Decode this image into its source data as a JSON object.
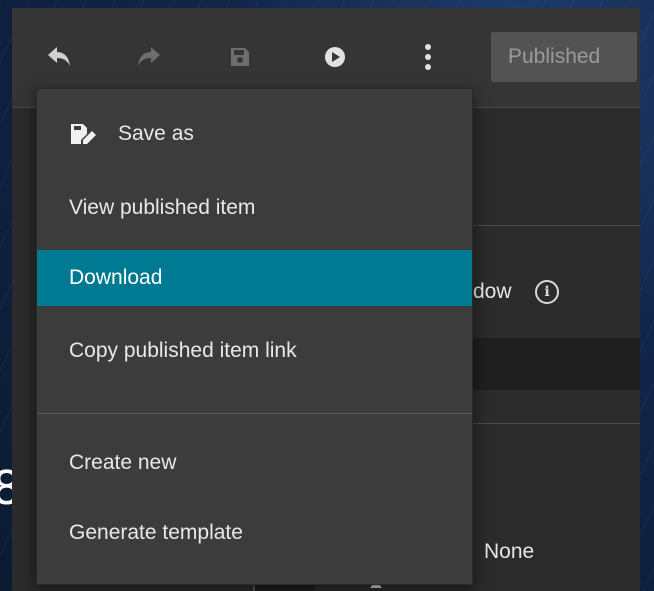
{
  "toolbar": {
    "undo_icon": "undo-icon",
    "redo_icon": "redo-icon",
    "save_icon": "save-icon",
    "preview_icon": "play-icon",
    "more_icon": "more-vertical-icon",
    "published_label": "Published"
  },
  "menu": {
    "items": [
      {
        "label": "Save as",
        "icon": "save-as-icon"
      },
      {
        "label": "View published item"
      },
      {
        "label": "Download",
        "state": "highlighted"
      },
      {
        "label": "Copy published item link"
      },
      {
        "label": "Create new"
      },
      {
        "label": "Generate template"
      }
    ],
    "highlight_color": "#007a92"
  },
  "panel": {
    "partial_label": "dow",
    "info_icon": "info-icon",
    "value_none": "None"
  },
  "background": {
    "partial_glyph": "8"
  }
}
